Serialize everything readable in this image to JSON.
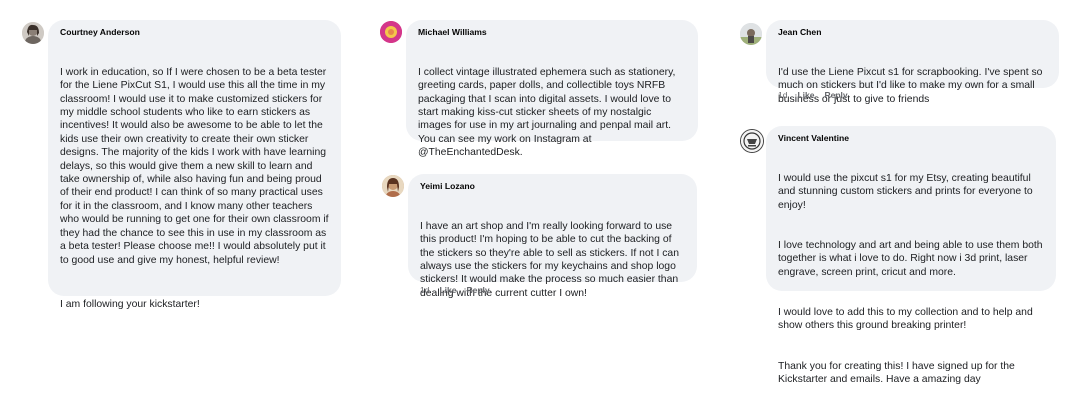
{
  "comments": [
    {
      "author": "Courtney Anderson",
      "paragraphs": [
        "I work in education, so If I were chosen to be a beta tester for the Liene PixCut S1, I would use this all the time in my classroom! I would use it to make customized stickers for my middle school students who like to earn stickers as incentives! It would also be awesome to be able to let the kids use their own creativity to create their own sticker designs. The majority of the kids I work with have learning delays, so this would give them a new skill to learn and take ownership of, while also having fun and being proud of their end product! I can think of so many practical uses for it in the classroom, and I know many other teachers who would be running to get one for their own classroom if they had the chance to see this in use in my classroom as a beta tester! Please choose me!! I would absolutely put it to good use and give my honest, helpful review!",
        "I am following your kickstarter!"
      ]
    },
    {
      "author": "Michael Williams",
      "paragraphs": [
        "I collect vintage illustrated ephemera such as stationery, greeting cards, paper dolls, and collectible toys NRFB packaging that I scan into digital assets. I would love to start making kiss-cut sticker sheets of my nostalgic images for use in my art journaling and penpal mail art. You can see my work on Instagram at @TheEnchantedDesk."
      ]
    },
    {
      "author": "Yeimi Lozano",
      "paragraphs": [
        "I have an art shop and I'm really looking forward to use this product! I'm hoping to be able to cut the backing of the stickers so they're able to sell as stickers. If not I can always use the stickers for my keychains and shop logo stickers! It would make the process so much easier than dealing with the current cutter I own!"
      ],
      "time": "1d",
      "like": "Like",
      "reply": "Reply"
    },
    {
      "author": "Jean Chen",
      "paragraphs": [
        "I'd use the Liene Pixcut s1 for scrapbooking. I've spent so much on stickers but I'd like to make my own for a small business or just to give to friends"
      ],
      "time": "1d",
      "like": "Like",
      "reply": "Reply"
    },
    {
      "author": "Vincent Valentine",
      "paragraphs": [
        "I would use the pixcut s1 for my Etsy, creating beautiful and stunning custom stickers and prints for everyone to enjoy!",
        "I love technology and art and being able to use them both together is what i love to do. Right now i 3d print, laser engrave, screen print, cricut and more.",
        "I would love to add this to my collection and to help and show others this ground breaking printer!",
        "Thank you for creating this! I have signed up for the Kickstarter and emails. Have a amazing day"
      ]
    }
  ]
}
